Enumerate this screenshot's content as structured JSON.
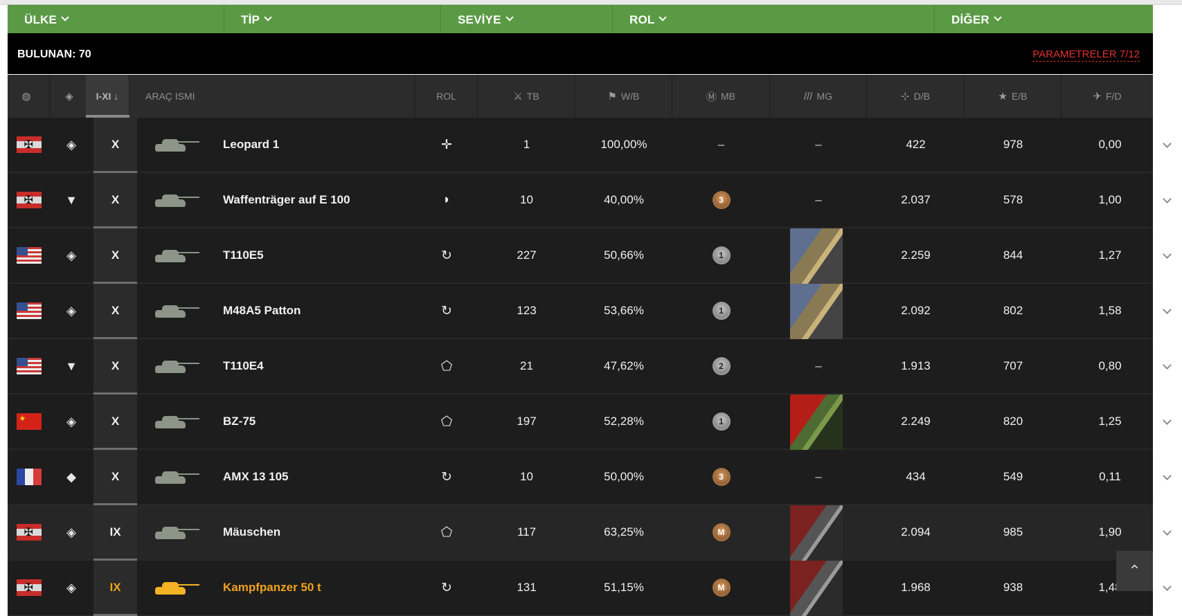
{
  "filters": [
    {
      "label": "ÜLKE"
    },
    {
      "label": "TİP"
    },
    {
      "label": "SEVİYE"
    },
    {
      "label": "ROL"
    },
    {
      "label": "DİĞER"
    }
  ],
  "found": "BULUNAN: 70",
  "params": "PARAMETRELER 7/12",
  "headers": {
    "tier": "I-XI ↓",
    "name": "ARAÇ ISMI",
    "role": "ROL",
    "tb": "TB",
    "wb": "W/B",
    "mb": "MB",
    "mg": "MG",
    "db": "D/B",
    "eb": "E/B",
    "fd": "F/D"
  },
  "rows": [
    {
      "flag": "de",
      "type": "◈",
      "tier": "X",
      "name": "Leopard 1",
      "role": "✛",
      "tb": "1",
      "wb": "100,00%",
      "mb": "–",
      "mg": "–",
      "db": "422",
      "eb": "978",
      "fd": "0,00",
      "gold": false
    },
    {
      "flag": "de",
      "type": "▼",
      "tier": "X",
      "name": "Waffenträger auf E 100",
      "role": "◗",
      "tb": "10",
      "wb": "40,00%",
      "mb": "3",
      "mg": "–",
      "db": "2.037",
      "eb": "578",
      "fd": "1,00",
      "gold": false
    },
    {
      "flag": "us",
      "type": "◈",
      "tier": "X",
      "name": "T110E5",
      "role": "↻",
      "tb": "227",
      "wb": "50,66%",
      "mb": "1",
      "mg": "us",
      "db": "2.259",
      "eb": "844",
      "fd": "1,27",
      "gold": false
    },
    {
      "flag": "us",
      "type": "◈",
      "tier": "X",
      "name": "M48A5 Patton",
      "role": "↻",
      "tb": "123",
      "wb": "53,66%",
      "mb": "1",
      "mg": "us",
      "db": "2.092",
      "eb": "802",
      "fd": "1,58",
      "gold": false
    },
    {
      "flag": "us",
      "type": "▼",
      "tier": "X",
      "name": "T110E4",
      "role": "⬠",
      "tb": "21",
      "wb": "47,62%",
      "mb": "2",
      "mg": "–",
      "db": "1.913",
      "eb": "707",
      "fd": "0,80",
      "gold": false
    },
    {
      "flag": "cn",
      "type": "◈",
      "tier": "X",
      "name": "BZ-75",
      "role": "⬠",
      "tb": "197",
      "wb": "52,28%",
      "mb": "1",
      "mg": "cn",
      "db": "2.249",
      "eb": "820",
      "fd": "1,25",
      "gold": false
    },
    {
      "flag": "fr",
      "type": "◆",
      "tier": "X",
      "name": "AMX 13 105",
      "role": "↻",
      "tb": "10",
      "wb": "50,00%",
      "mb": "3",
      "mg": "–",
      "db": "434",
      "eb": "549",
      "fd": "0,11",
      "gold": false
    },
    {
      "flag": "de",
      "type": "◈",
      "tier": "IX",
      "name": "Mäuschen",
      "role": "⬠",
      "tb": "117",
      "wb": "63,25%",
      "mb": "M",
      "mg": "de",
      "db": "2.094",
      "eb": "985",
      "fd": "1,90",
      "gold": false
    },
    {
      "flag": "de",
      "type": "◈",
      "tier": "IX",
      "name": "Kampfpanzer 50 t",
      "role": "↻",
      "tb": "131",
      "wb": "51,15%",
      "mb": "M",
      "mg": "de",
      "db": "1.968",
      "eb": "938",
      "fd": "1,48",
      "gold": true
    }
  ],
  "scrolltop": "⌃"
}
